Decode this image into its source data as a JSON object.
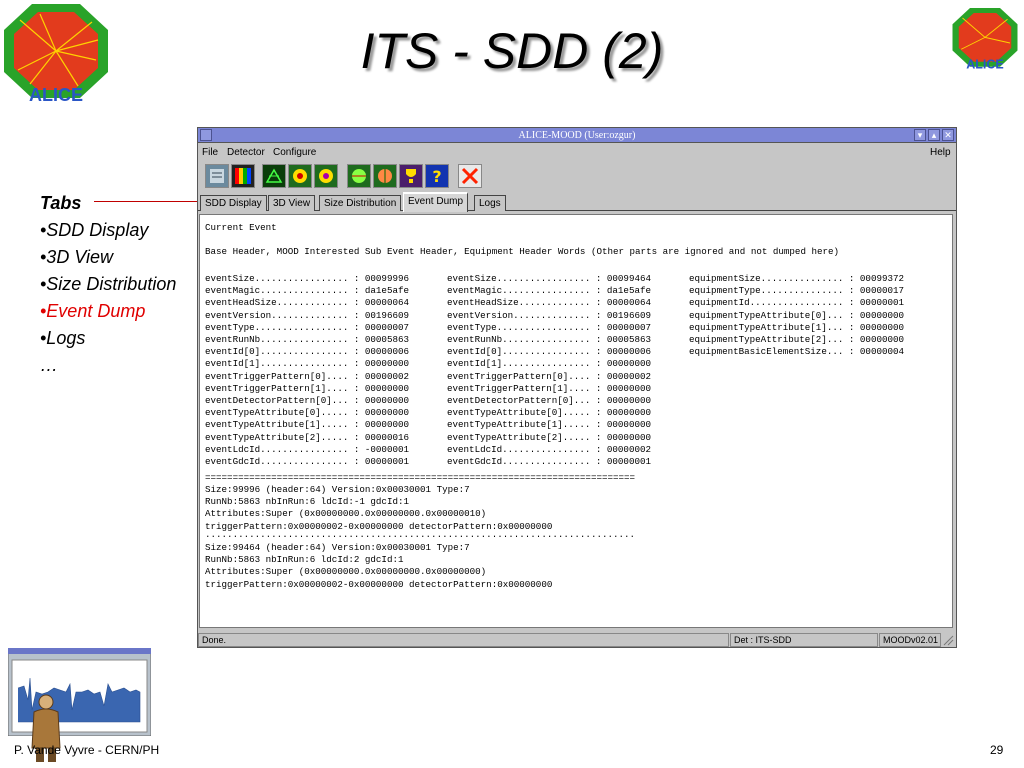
{
  "slide": {
    "title": "ITS - SDD (2)",
    "logo_text": "ALICE",
    "footer_author": "P. Vande Vyvre - CERN/PH",
    "page_number": "29"
  },
  "tabs_list": {
    "heading": "Tabs",
    "items": [
      {
        "label": "•SDD Display",
        "active": false
      },
      {
        "label": "•3D View",
        "active": false
      },
      {
        "label": "•Size Distribution",
        "active": false
      },
      {
        "label": "•Event Dump",
        "active": true
      },
      {
        "label": "•Logs",
        "active": false
      },
      {
        "label": "…",
        "active": false
      }
    ]
  },
  "window": {
    "title": "ALICE-MOOD (User:ozgur)",
    "menu": {
      "file": "File",
      "detector": "Detector",
      "configure": "Configure",
      "help": "Help"
    },
    "tabs": [
      "SDD Display",
      "3D View",
      "Size Distribution",
      "Event Dump",
      "Logs"
    ],
    "active_tab": "Event Dump",
    "status": {
      "message": "Done.",
      "detector": "Det : ITS-SDD",
      "version": "MOODv02.01"
    },
    "dump": {
      "heading": "Current Event",
      "subheading": "Base Header, MOOD Interested Sub Event Header, Equipment Header Words (Other parts are ignored and not dumped here)",
      "col1": [
        "eventSize................. : 00099996",
        "eventMagic................ : da1e5afe",
        "eventHeadSize............. : 00000064",
        "eventVersion.............. : 00196609",
        "eventType................. : 00000007",
        "eventRunNb................ : 00005863",
        "eventId[0]................ : 00000006",
        "eventId[1]................ : 00000000",
        "eventTriggerPattern[0].... : 00000002",
        "eventTriggerPattern[1].... : 00000000",
        "eventDetectorPattern[0]... : 00000000",
        "eventTypeAttribute[0]..... : 00000000",
        "eventTypeAttribute[1]..... : 00000000",
        "eventTypeAttribute[2]..... : 00000016",
        "eventLdcId................ : -0000001",
        "eventGdcId................ : 00000001"
      ],
      "col2": [
        "eventSize................. : 00099464",
        "eventMagic................ : da1e5afe",
        "eventHeadSize............. : 00000064",
        "eventVersion.............. : 00196609",
        "eventType................. : 00000007",
        "eventRunNb................ : 00005863",
        "eventId[0]................ : 00000006",
        "eventId[1]................ : 00000000",
        "eventTriggerPattern[0].... : 00000002",
        "eventTriggerPattern[1].... : 00000000",
        "eventDetectorPattern[0]... : 00000000",
        "eventTypeAttribute[0]..... : 00000000",
        "eventTypeAttribute[1]..... : 00000000",
        "eventTypeAttribute[2]..... : 00000000",
        "eventLdcId................ : 00000002",
        "eventGdcId................ : 00000001"
      ],
      "col3": [
        "equipmentSize............... : 00099372",
        "equipmentType............... : 00000017",
        "equipmentId................. : 00000001",
        "equipmentTypeAttribute[0]... : 00000000",
        "equipmentTypeAttribute[1]... : 00000000",
        "equipmentTypeAttribute[2]... : 00000000",
        "equipmentBasicElementSize... : 00000004"
      ],
      "separator": "==============================================================================",
      "block1": "Size:99996 (header:64) Version:0x00030001 Type:7\nRunNb:5863 nbInRun:6 ldcId:-1 gdcId:1\nAttributes:Super (0x00000000.0x00000000.0x00000010)\ntriggerPattern:0x00000002-0x00000000 detectorPattern:0x00000000",
      "dots": "..............................................................................",
      "block2": "Size:99464 (header:64) Version:0x00030001 Type:7\nRunNb:5863 nbInRun:6 ldcId:2 gdcId:1\nAttributes:Super (0x00000000.0x00000000.0x00000000)\ntriggerPattern:0x00000002-0x00000000 detectorPattern:0x00000000"
    }
  },
  "colors": {
    "titlebar": "#7c86d6",
    "accent_red": "#e00000",
    "panel": "#c6c6c6"
  }
}
